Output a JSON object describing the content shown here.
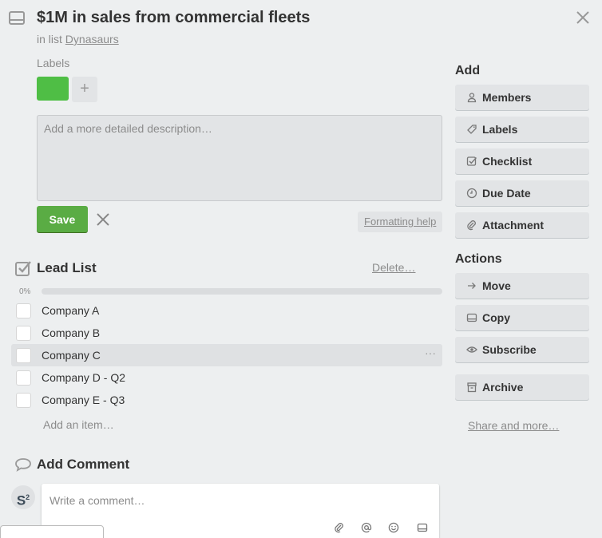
{
  "card": {
    "title": "$1M in sales from commercial fleets",
    "in_list_prefix": "in list",
    "list_name": "Dynasaurs"
  },
  "labels": {
    "heading": "Labels",
    "add_symbol": "+",
    "green_color": "#4fbe45"
  },
  "description": {
    "placeholder": "Add a more detailed description…",
    "save_label": "Save",
    "formatting_help": "Formatting help"
  },
  "checklist": {
    "title": "Lead List",
    "delete_label": "Delete…",
    "progress_text": "0%",
    "progress_fraction": 0,
    "items": [
      {
        "label": "Company A"
      },
      {
        "label": "Company B"
      },
      {
        "label": "Company C",
        "more": "···"
      },
      {
        "label": "Company D - Q2"
      },
      {
        "label": "Company E - Q3"
      }
    ],
    "add_item": "Add an item…"
  },
  "comment": {
    "heading": "Add Comment",
    "placeholder": "Write a comment…",
    "avatar_initials": "S",
    "avatar_sup": "2"
  },
  "sidebar": {
    "add_heading": "Add",
    "add_buttons": [
      {
        "label": "Members",
        "icon": "person-icon"
      },
      {
        "label": "Labels",
        "icon": "tag-icon"
      },
      {
        "label": "Checklist",
        "icon": "checkbox-icon"
      },
      {
        "label": "Due Date",
        "icon": "clock-icon"
      },
      {
        "label": "Attachment",
        "icon": "paperclip-icon"
      }
    ],
    "actions_heading": "Actions",
    "action_buttons": [
      {
        "label": "Move",
        "icon": "arrow-right-icon"
      },
      {
        "label": "Copy",
        "icon": "card-icon"
      },
      {
        "label": "Subscribe",
        "icon": "eye-icon"
      },
      {
        "label": "Archive",
        "icon": "archive-icon"
      }
    ],
    "share_label": "Share and more…"
  },
  "colors": {
    "background": "#edeff0",
    "save_green": "#5aac44",
    "button_gray": "#e2e4e6"
  }
}
